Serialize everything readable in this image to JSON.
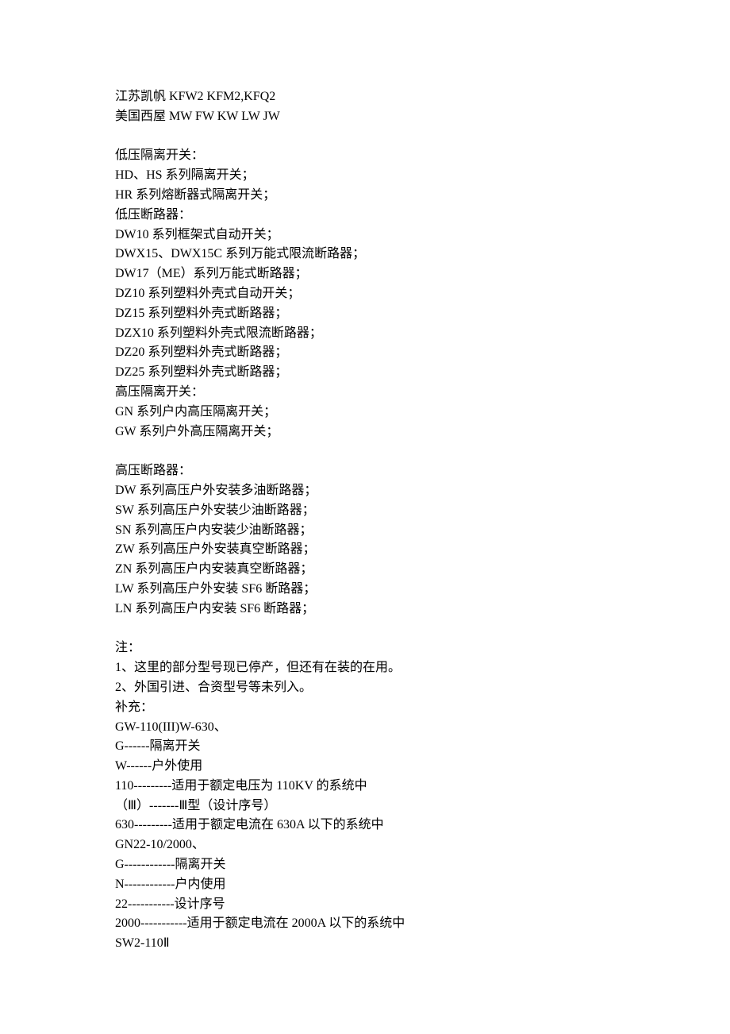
{
  "lines": [
    "江苏凯帆 KFW2 KFM2,KFQ2",
    "美国西屋 MW FW KW LW JW",
    "",
    "低压隔离开关：",
    "HD、HS 系列隔离开关；",
    "HR 系列熔断器式隔离开关；",
    "低压断路器：",
    "DW10 系列框架式自动开关；",
    "DWX15、DWX15C 系列万能式限流断路器；",
    "DW17（ME）系列万能式断路器；",
    "DZ10 系列塑料外壳式自动开关；",
    "DZ15 系列塑料外壳式断路器；",
    "DZX10 系列塑料外壳式限流断路器；",
    "DZ20 系列塑料外壳式断路器；",
    "DZ25 系列塑料外壳式断路器；",
    "高压隔离开关：",
    "GN 系列户内高压隔离开关；",
    "GW 系列户外高压隔离开关；",
    "",
    "高压断路器：",
    "DW 系列高压户外安装多油断路器；",
    "SW 系列高压户外安装少油断路器；",
    "SN 系列高压户内安装少油断路器；",
    "ZW 系列高压户外安装真空断路器；",
    "ZN 系列高压户内安装真空断路器；",
    "LW 系列高压户外安装 SF6 断路器；",
    "LN 系列高压户内安装 SF6 断路器；",
    "",
    "注：",
    "1、这里的部分型号现已停产，但还有在装的在用。",
    "2、外国引进、合资型号等未列入。",
    "补充：",
    "GW-110(III)W-630、",
    "G------隔离开关",
    "W------户外使用",
    "110---------适用于额定电压为 110KV 的系统中",
    "（Ⅲ）-------Ⅲ型（设计序号）",
    "630---------适用于额定电流在 630A 以下的系统中",
    "GN22-10/2000、",
    "G------------隔离开关",
    "N------------户内使用",
    "22-----------设计序号",
    "2000-----------适用于额定电流在 2000A 以下的系统中",
    "SW2-110Ⅱ"
  ],
  "watermark": ""
}
